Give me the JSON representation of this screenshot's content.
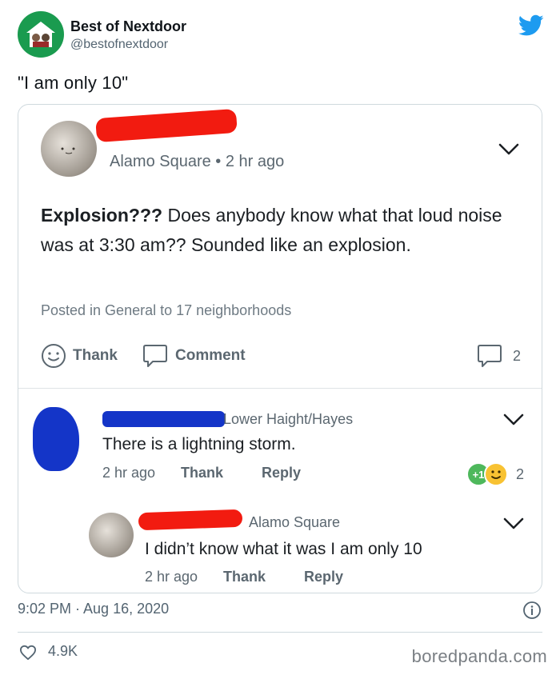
{
  "tweet": {
    "author_name": "Best of Nextdoor",
    "author_handle": "@bestofnextdoor",
    "text": "\"I am only 10\"",
    "timestamp": "9:02 PM · Aug 16, 2020",
    "likes": "4.9K"
  },
  "post": {
    "location_meta": "Alamo Square • 2 hr ago",
    "title": "Explosion???",
    "body": " Does anybody know what that loud noise was at 3:30 am?? Sounded like an explosion.",
    "posted_in": "Posted in General to 17 neighborhoods",
    "thank_label": "Thank",
    "comment_label": "Comment",
    "comment_count": "2"
  },
  "comment1": {
    "location": "Lower Haight/Hayes",
    "text": "There is a lightning storm.",
    "time": "2 hr ago",
    "thank_label": "Thank",
    "reply_label": "Reply",
    "reaction_badge": "+1",
    "reaction_count": "2"
  },
  "comment2": {
    "location": "Alamo Square",
    "text": "I didn’t know what it was I am only 10",
    "time": "2 hr ago",
    "thank_label": "Thank",
    "reply_label": "Reply"
  },
  "watermark": "boredpanda.com",
  "colors": {
    "redaction_red": "#f21b10",
    "redaction_blue": "#1435c8",
    "twitter_blue": "#1d9bf0",
    "nextdoor_green": "#1a9b4f"
  }
}
